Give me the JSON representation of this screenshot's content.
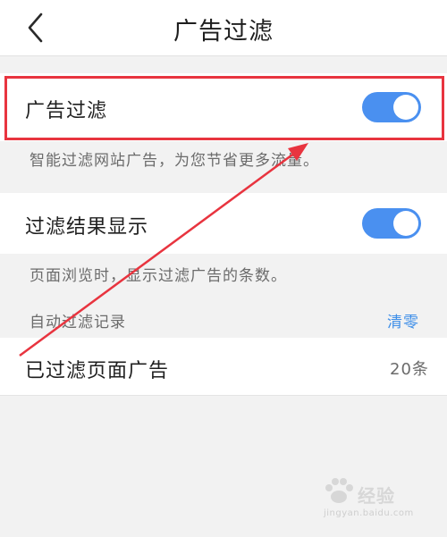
{
  "nav": {
    "title": "广告过滤",
    "back_icon": "chevron-left-icon"
  },
  "ad_filter": {
    "label": "广告过滤",
    "enabled": true,
    "hint": "智能过滤网站广告，为您节省更多流量。"
  },
  "result_display": {
    "label": "过滤结果显示",
    "enabled": true,
    "hint": "页面浏览时，显示过滤广告的条数。"
  },
  "records": {
    "header": "自动过滤记录",
    "clear_label": "清零",
    "filtered_label": "已过滤页面广告",
    "filtered_count": "20条"
  },
  "watermark": {
    "text": "经验",
    "sub": "jingyan.baidu.com"
  },
  "colors": {
    "accent": "#4a90f0",
    "link": "#3d8ee8",
    "highlight": "#e8343f"
  }
}
